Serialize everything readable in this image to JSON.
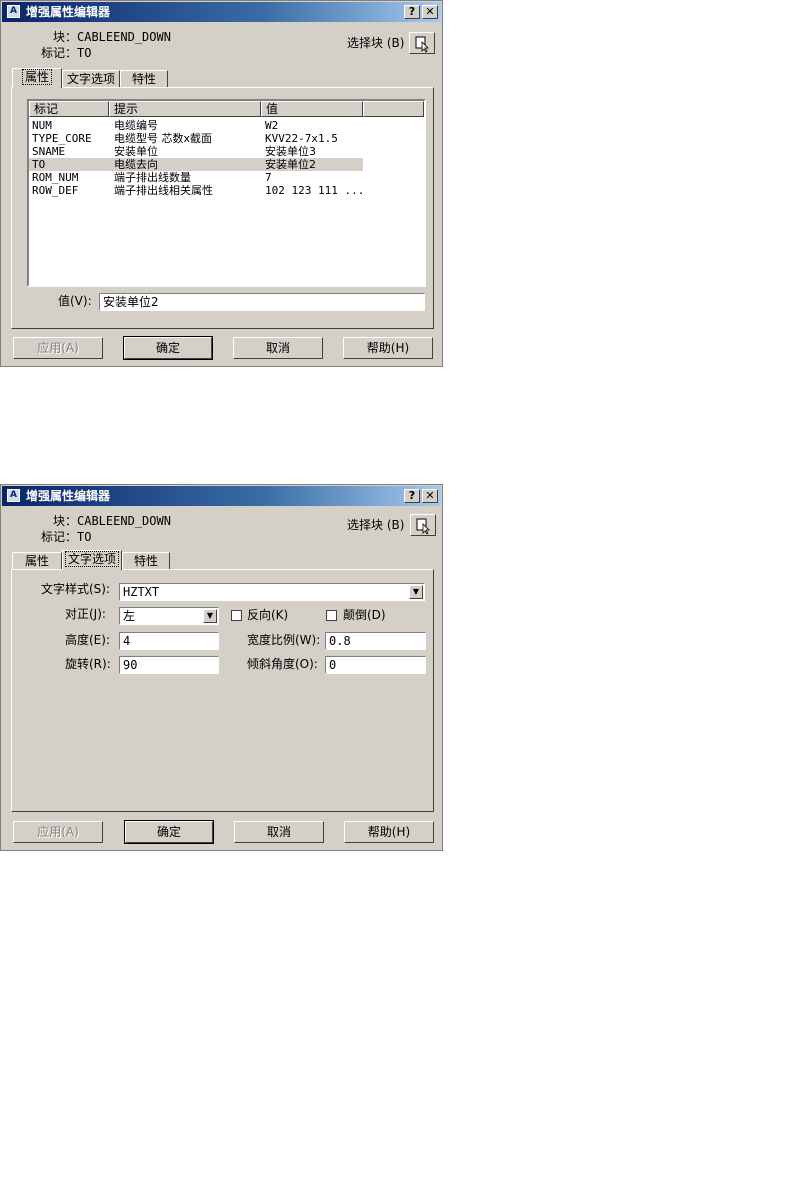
{
  "dialogs": [
    {
      "title": "增强属性编辑器",
      "help_btn": "?",
      "close_btn": "✕",
      "block_label": "块：CABLEEND_DOWN",
      "tag_label": "标记：TO",
      "select_block_label": "选择块 (B)",
      "tabs": [
        "属性",
        "文字选项",
        "特性"
      ],
      "active_tab": 0,
      "columns": [
        "标记",
        "提示",
        "值"
      ],
      "rows": [
        [
          "NUM",
          "电缆编号",
          "W2"
        ],
        [
          "TYPE_CORE",
          "电缆型号 芯数x截面",
          "KVV22-7x1.5"
        ],
        [
          "SNAME",
          "安装单位",
          "安装单位3"
        ],
        [
          "TO",
          "电缆去向",
          "安装单位2"
        ],
        [
          "ROM_NUM",
          "端子排出线数量",
          "7"
        ],
        [
          "ROW_DEF",
          "端子排出线相关属性",
          "102 123 111 ..."
        ]
      ],
      "selected_row": 3,
      "value_label": "值(V):",
      "value_input": "安装单位2",
      "buttons": {
        "apply": "应用(A)",
        "ok": "确定",
        "cancel": "取消",
        "help": "帮助(H)"
      }
    },
    {
      "title": "增强属性编辑器",
      "help_btn": "?",
      "close_btn": "✕",
      "block_label": "块：CABLEEND_DOWN",
      "tag_label": "标记：TO",
      "select_block_label": "选择块 (B)",
      "tabs": [
        "属性",
        "文字选项",
        "特性"
      ],
      "active_tab": 1,
      "text_style_label": "文字样式(S):",
      "text_style_value": "HZTXT",
      "justify_label": "对正(J):",
      "justify_value": "左",
      "backwards_label": "反向(K)",
      "upside_down_label": "颠倒(D)",
      "height_label": "高度(E):",
      "height_value": "4",
      "width_factor_label": "宽度比例(W):",
      "width_factor_value": "0.8",
      "rotation_label": "旋转(R):",
      "rotation_value": "90",
      "oblique_label": "倾斜角度(O):",
      "oblique_value": "0",
      "buttons": {
        "apply": "应用(A)",
        "ok": "确定",
        "cancel": "取消",
        "help": "帮助(H)"
      }
    }
  ]
}
